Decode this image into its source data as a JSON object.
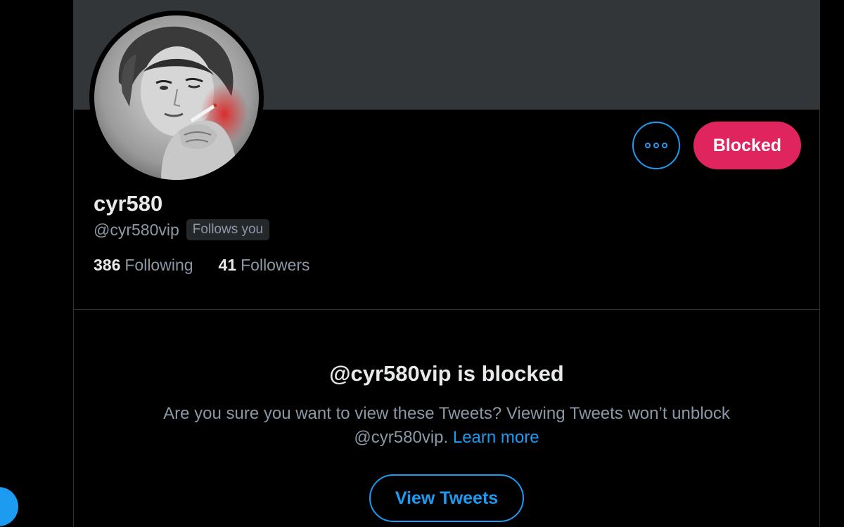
{
  "profile": {
    "display_name": "cyr580",
    "handle": "@cyr580vip",
    "follows_you_badge": "Follows you",
    "following_count": "386",
    "following_label": "Following",
    "followers_count": "41",
    "followers_label": "Followers"
  },
  "actions": {
    "more_icon": "more-horizontal-icon",
    "blocked_label": "Blocked"
  },
  "blocked_notice": {
    "title": "@cyr580vip is blocked",
    "message": "Are you sure you want to view these Tweets? Viewing Tweets won’t unblock @cyr580vip.",
    "learn_more": "Learn more",
    "view_button": "View Tweets"
  },
  "colors": {
    "accent": "#1d9bf0",
    "blocked": "#e0245e",
    "banner": "#333639",
    "background": "#000000"
  }
}
